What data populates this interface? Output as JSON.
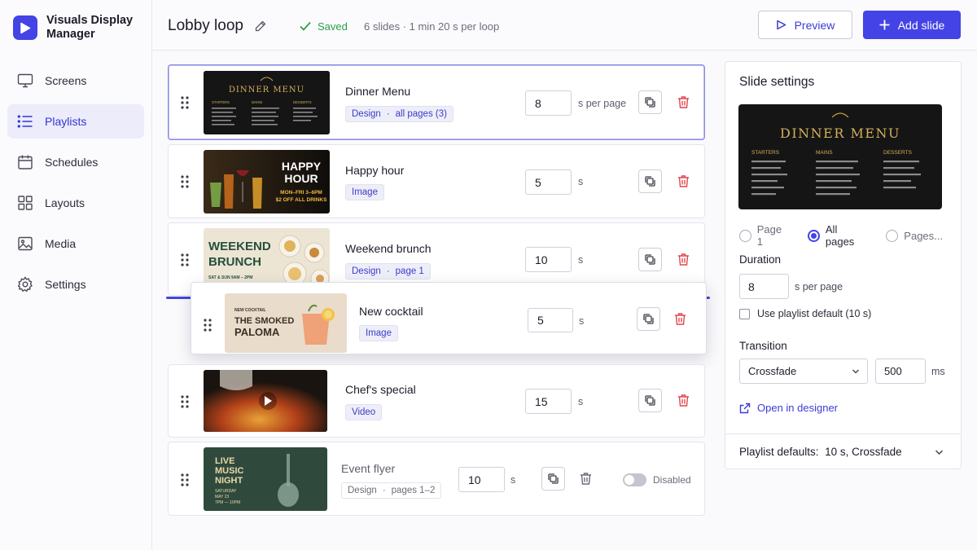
{
  "brand": {
    "name": "Visuals Display Manager"
  },
  "nav": [
    {
      "label": "Screens",
      "icon": "monitor-icon"
    },
    {
      "label": "Playlists",
      "icon": "list-icon",
      "active": true
    },
    {
      "label": "Schedules",
      "icon": "calendar-icon"
    },
    {
      "label": "Layouts",
      "icon": "layout-grid-icon"
    },
    {
      "label": "Media",
      "icon": "image-icon"
    },
    {
      "label": "Settings",
      "icon": "gear-icon"
    }
  ],
  "header": {
    "title": "Lobby loop",
    "saved": "Saved",
    "meta": "6 slides · 1 min 20 s per loop",
    "preview": "Preview",
    "add_slide": "Add slide"
  },
  "slides": [
    {
      "name": "Dinner Menu",
      "tag_type": "Design",
      "tag_detail": "all pages (3)",
      "duration": "8",
      "unit": "s per page",
      "selected": true
    },
    {
      "name": "Happy hour",
      "tag_type": "Image",
      "tag_detail": "",
      "duration": "5",
      "unit": "s"
    },
    {
      "name": "Weekend brunch",
      "tag_type": "Design",
      "tag_detail": "page 1",
      "duration": "10",
      "unit": "s"
    },
    {
      "name": "New cocktail",
      "tag_type": "Image",
      "tag_detail": "",
      "duration": "5",
      "unit": "s",
      "dragging": true
    },
    {
      "name": "Chef's special",
      "tag_type": "Video",
      "tag_detail": "",
      "duration": "15",
      "unit": "s"
    },
    {
      "name": "Event flyer",
      "tag_type": "Design",
      "tag_detail": "pages 1–2",
      "duration": "10",
      "unit": "s",
      "status": "Disabled"
    }
  ],
  "thumbs": {
    "dinner": {
      "title": "DINNER MENU",
      "cols": [
        "STARTERS",
        "MAINS",
        "DESSERTS"
      ]
    },
    "happy": {
      "line1": "HAPPY",
      "line2": "HOUR",
      "sub1": "MON–FRI 3–6PM",
      "sub2": "$2 OFF ALL DRINKS"
    },
    "brunch": {
      "line1": "WEEKEND",
      "line2": "BRUNCH",
      "sub": "SAT & SUN 9AM – 2PM"
    },
    "cocktail": {
      "kicker": "NEW COCKTAIL",
      "line1": "THE SMOKED",
      "line2": "PALOMA"
    },
    "event": {
      "line1": "LIVE",
      "line2": "MUSIC",
      "line3": "NIGHT",
      "sub1": "SATURDAY",
      "sub2": "MAY 23",
      "sub3": "7PM — 10PM"
    }
  },
  "settings": {
    "title": "Slide settings",
    "pages_options": [
      "Page 1",
      "All pages",
      "Pages..."
    ],
    "pages_selected": "All pages",
    "duration_label": "Duration",
    "duration_value": "8",
    "duration_unit": "s per page",
    "use_default": "Use playlist default (10 s)",
    "transition_label": "Transition",
    "transition_value": "Crossfade",
    "transition_ms": "500",
    "ms_unit": "ms",
    "open_designer": "Open in designer",
    "defaults_label": "Playlist defaults:",
    "defaults_value": "10 s, Crossfade"
  },
  "colors": {
    "accent": "#4343e6",
    "delete": "#e0474d",
    "saved": "#2f9b4f"
  }
}
